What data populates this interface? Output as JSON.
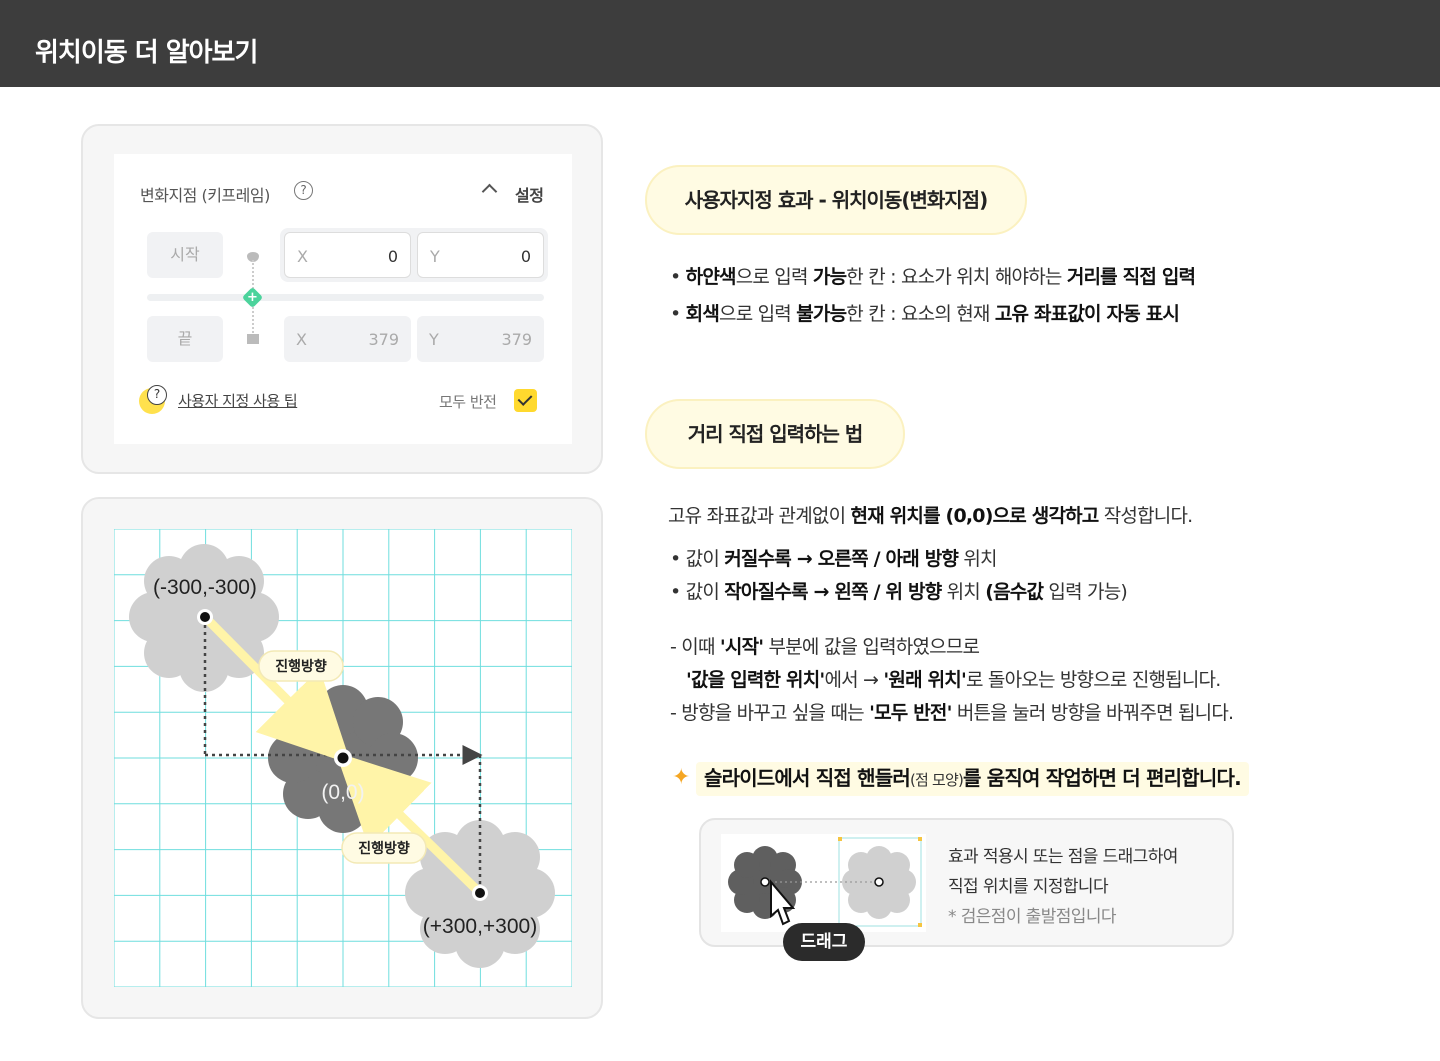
{
  "header": {
    "title": "위치이동 더 알아보기"
  },
  "keyframe_panel": {
    "title": "변화지점 (키프레임)",
    "help_icon": "?",
    "setting_label": "설정",
    "start": {
      "label": "시작",
      "x_label": "X",
      "x_value": "0",
      "y_label": "Y",
      "y_value": "0"
    },
    "end": {
      "label": "끝",
      "x_label": "X",
      "x_value": "379",
      "y_label": "Y",
      "y_value": "379"
    },
    "add_point_icon": "+",
    "tip_icon": "?",
    "tip_link": "사용자 지정 사용 팁",
    "invert_label": "모두 반전"
  },
  "grid_figure": {
    "label_topleft": "(-300,-300)",
    "label_center": "(0,0)",
    "label_bottomright": "(+300,+300)",
    "direction_label_1": "진행방향",
    "direction_label_2": "진행방향"
  },
  "section1": {
    "pill": "사용자지정 효과 - 위치이동(변화지점)",
    "bullet1": {
      "pre": "• ",
      "b1": "하얀색",
      "t1": "으로 입력 ",
      "b2": "가능",
      "t2": "한 칸 : 요소가 위치 해야하는 ",
      "b3": "거리를 직접 입력"
    },
    "bullet2": {
      "pre": "• ",
      "b1": "회색",
      "t1": "으로 입력 ",
      "b2": "불가능",
      "t2": "한 칸 : 요소의 현재 ",
      "b3": "고유 좌표값이 자동 표시"
    }
  },
  "section2": {
    "pill": "거리 직접 입력하는 법",
    "intro": {
      "t1": "고유 좌표값과 관계없이 ",
      "b1": "현재 위치를 (0,0)으로 생각하고",
      "t2": " 작성합니다."
    },
    "bullet1": {
      "pre": "• 값이 ",
      "b1": "커질수록 → 오른쪽 / 아래 방향",
      "t1": " 위치"
    },
    "bullet2": {
      "pre": "• 값이 ",
      "b1": "작아질수록 → 왼쪽 / 위 방향",
      "t1": " 위치 ",
      "b2": "(음수값",
      "t2": " 입력 가능)"
    },
    "note1": {
      "t1": "- 이때 ",
      "b1": "'시작'",
      "t2": " 부분에 값을 입력하였으므로"
    },
    "note2": {
      "b1": "'값을 입력한 위치'",
      "t1": "에서 → ",
      "b2": "'원래 위치'",
      "t2": "로 돌아오는 방향으로 진행됩니다."
    },
    "note3": {
      "t1": "- 방향을 바꾸고 싶을 때는 ",
      "b1": "'모두 반전'",
      "t2": " 버튼을 눌러 방향을 바꿔주면 됩니다."
    },
    "tip": {
      "b1": "슬라이드에서 직접 핸들러",
      "small": "(점 모양)",
      "b2": "를 움직여 작업하면 더 편리합니다."
    }
  },
  "demo": {
    "line1": "효과 적용시 또는 점을 드래그하여",
    "line2": "직접 위치를 지정합니다",
    "note": "* 검은점이 출발점입니다",
    "drag_label": "드래그"
  },
  "colors": {
    "header_bg": "#3d3d3d",
    "pill_bg": "#fffbe3",
    "accent_yellow": "#ffd92e",
    "grid_line": "#6fdede",
    "cloud_light": "#cfcfcf",
    "cloud_dark": "#777777",
    "arrow": "#fff4a8"
  }
}
